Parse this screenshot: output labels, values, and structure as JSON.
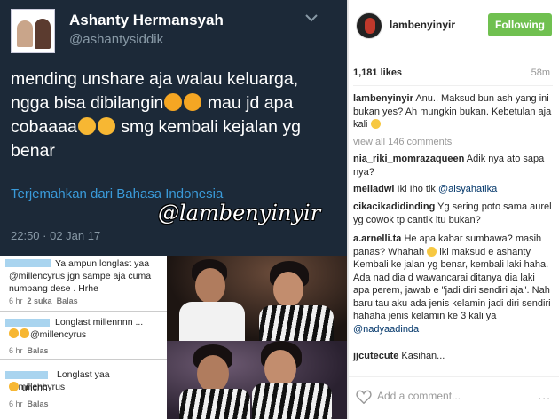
{
  "tweet": {
    "name": "Ashanty Hermansyah",
    "handle": "@ashantysiddik",
    "text_parts": [
      "mending unshare aja walau keluarga, ngga bisa dibilangin",
      "mau jd apa cobaaaa",
      "smg kembali kejalan yg benar"
    ],
    "translate": "Terjemahkan dari Bahasa Indonesia",
    "time": "22:50 · 02 Jan 17"
  },
  "watermark": "@lambenyinyir",
  "comment_screens": [
    {
      "text": "Ya ampun longlast yaa @millencyrus jgn sampe aja cuma numpang dese . Hrhe",
      "meta_time": "6 hr",
      "meta_likes": "2 suka",
      "meta_reply": "Balas"
    },
    {
      "text": "Longlast millennnn ...",
      "text2": "@millencyrus",
      "meta_time": "6 hr",
      "meta_reply": "Balas"
    },
    {
      "text": "Longlast yaa @millencyrus",
      "text2": "unchh",
      "meta_time": "6 hr",
      "meta_reply": "Balas"
    }
  ],
  "ig": {
    "username": "lambenyinyir",
    "follow_label": "Following",
    "likes": "1,181 likes",
    "age": "58m",
    "view_all": "view all 146 comments",
    "add_comment": "Add a comment...",
    "more": "...",
    "caption": {
      "user": "lambenyinyir",
      "text": "Anu.. Maksud bun ash yang ini bukan yes? Ah mungkin bukan. Kebetulan aja kali"
    },
    "comments": [
      {
        "user": "nia_riki_momrazaqueen",
        "text": "Adik nya ato sapa nya?"
      },
      {
        "user": "meliadwi",
        "text": "Iki Iho tik",
        "mention": "@aisyahatika"
      },
      {
        "user": "cikacikadidinding",
        "text": "Yg sering poto sama aurel yg cowok tp cantik itu bukan?"
      },
      {
        "user": "a.arnelli.ta",
        "text": "He apa kabar sumbawa? masih panas? Whahah",
        "text_b": "iki maksud e ashanty Kembali ke jalan yg benar, kembali laki haha. Ada nad dia d wawancarai ditanya dia laki apa perem, jawab e \"jadi diri sendiri aja\". Nah baru tau aku ada jenis kelamin jadi diri sendiri hahaha jenis kelamin ke 3 kali ya",
        "mention": "@nadyaadinda"
      },
      {
        "user": "jjcutecute",
        "text": "Kasihan..."
      }
    ]
  },
  "colors": {
    "tweet_bg": "#1c2938",
    "follow_green": "#70c050",
    "link_blue": "#3a9ad9"
  }
}
